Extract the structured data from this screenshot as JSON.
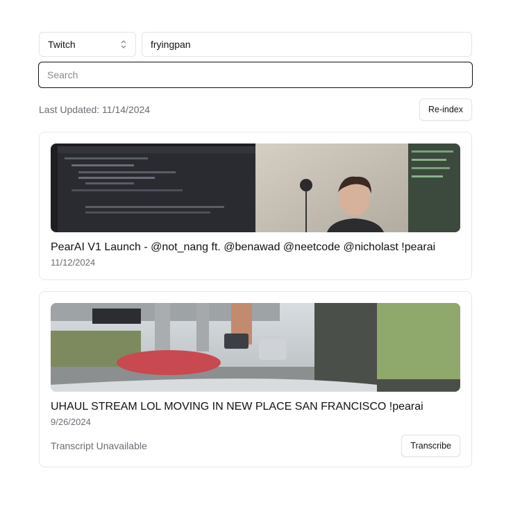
{
  "platform_select": {
    "value": "Twitch",
    "icon": "chevron-up-down-icon"
  },
  "channel_input": {
    "value": "fryingpan"
  },
  "search": {
    "placeholder": "Search",
    "value": ""
  },
  "index_status": {
    "last_updated": "Last Updated: 11/14/2024",
    "reindex_label": "Re-index"
  },
  "videos": [
    {
      "title": "PearAI V1 Launch - @not_nang ft. @benawad @neetcode @nicholast !pearai",
      "date": "11/12/2024"
    },
    {
      "title": "UHAUL STREAM LOL MOVING IN NEW PLACE SAN FRANCISCO !pearai",
      "date": "9/26/2024",
      "transcript_status": "Transcript Unavailable",
      "transcribe_label": "Transcribe"
    }
  ]
}
